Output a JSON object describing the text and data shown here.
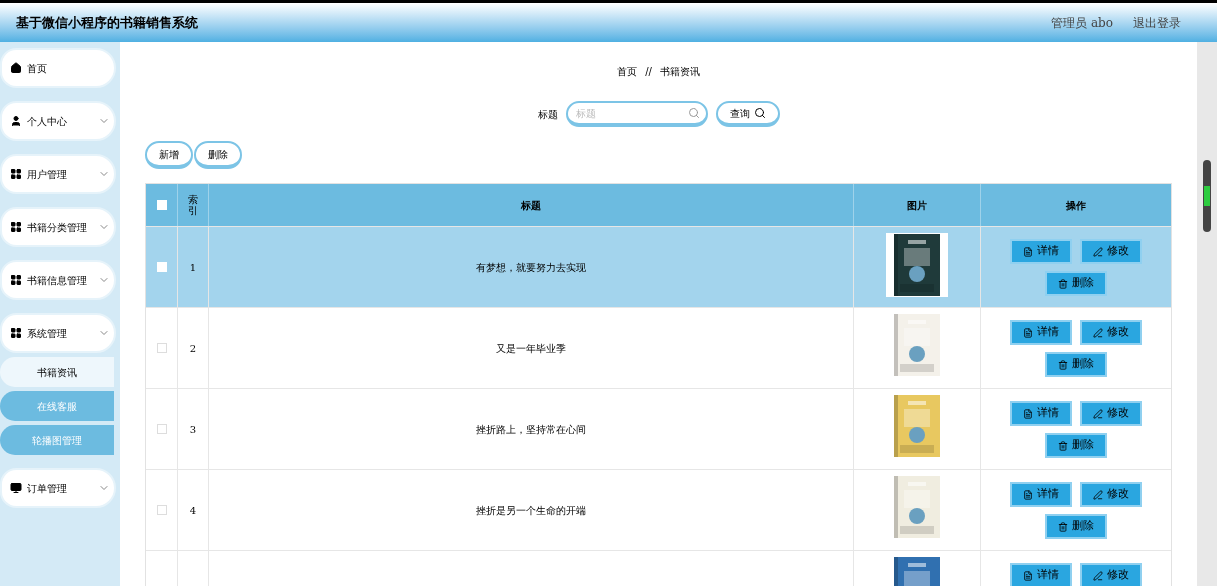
{
  "header": {
    "title": "基于微信小程序的书籍销售系统",
    "user": "管理员 abo",
    "logout": "退出登录"
  },
  "sidebar": {
    "items": [
      {
        "label": "首页",
        "kind": "home"
      },
      {
        "label": "个人中心",
        "kind": "user"
      },
      {
        "label": "用户管理",
        "kind": "grid"
      },
      {
        "label": "书籍分类管理",
        "kind": "grid"
      },
      {
        "label": "书籍信息管理",
        "kind": "grid"
      },
      {
        "label": "系统管理",
        "kind": "grid",
        "children": [
          {
            "label": "书籍资讯",
            "selected": true
          },
          {
            "label": "在线客服",
            "selected": false
          },
          {
            "label": "轮播图管理",
            "selected": false
          }
        ]
      },
      {
        "label": "订单管理",
        "kind": "monitor"
      }
    ]
  },
  "breadcrumb": [
    "首页",
    "//",
    "书籍资讯"
  ],
  "search": {
    "label": "标题",
    "placeholder": "标题",
    "button": "查询"
  },
  "toolbar": [
    "新增",
    "删除"
  ],
  "table": {
    "select_all": {
      "checked": false
    },
    "columns": [
      "索引",
      "标题",
      "图片",
      "操作"
    ],
    "rows": [
      {
        "index": "1",
        "title": "有梦想，就要努力去实现",
        "selected": true,
        "checked": false,
        "actions": [
          "详情",
          "修改",
          "删除"
        ]
      },
      {
        "index": "2",
        "title": "又是一年毕业季",
        "selected": false,
        "checked": false,
        "actions": [
          "详情",
          "修改",
          "删除"
        ]
      },
      {
        "index": "3",
        "title": "挫折路上，坚持常在心间",
        "selected": false,
        "checked": false,
        "actions": [
          "详情",
          "修改",
          "删除"
        ]
      },
      {
        "index": "4",
        "title": "挫折是另一个生命的开端",
        "selected": false,
        "checked": false,
        "actions": [
          "详情",
          "修改",
          "删除"
        ]
      },
      {
        "selected": false,
        "actions": [
          "详情",
          "修改"
        ]
      }
    ]
  }
}
